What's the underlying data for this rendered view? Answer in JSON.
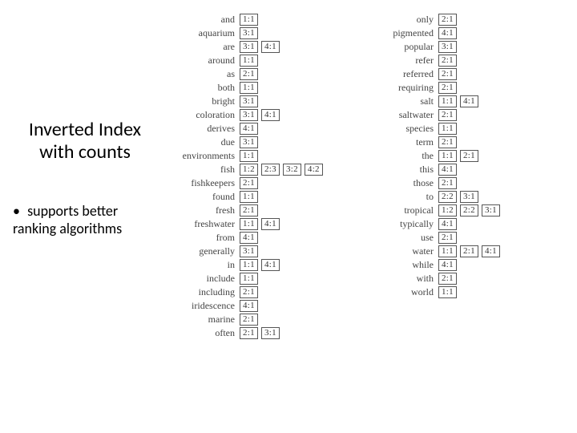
{
  "title_line1": "Inverted Index",
  "title_line2": "with counts",
  "bullet_dot": "•",
  "bullet_line1": "supports better",
  "bullet_line2": "ranking algorithms",
  "col1": [
    {
      "term": "and",
      "postings": [
        "1:1"
      ]
    },
    {
      "term": "aquarium",
      "postings": [
        "3:1"
      ]
    },
    {
      "term": "are",
      "postings": [
        "3:1",
        "4:1"
      ]
    },
    {
      "term": "around",
      "postings": [
        "1:1"
      ]
    },
    {
      "term": "as",
      "postings": [
        "2:1"
      ]
    },
    {
      "term": "both",
      "postings": [
        "1:1"
      ]
    },
    {
      "term": "bright",
      "postings": [
        "3:1"
      ]
    },
    {
      "term": "coloration",
      "postings": [
        "3:1",
        "4:1"
      ]
    },
    {
      "term": "derives",
      "postings": [
        "4:1"
      ]
    },
    {
      "term": "due",
      "postings": [
        "3:1"
      ]
    },
    {
      "term": "environments",
      "postings": [
        "1:1"
      ]
    },
    {
      "term": "fish",
      "postings": [
        "1:2",
        "2:3",
        "3:2",
        "4:2"
      ]
    },
    {
      "term": "fishkeepers",
      "postings": [
        "2:1"
      ]
    },
    {
      "term": "found",
      "postings": [
        "1:1"
      ]
    },
    {
      "term": "fresh",
      "postings": [
        "2:1"
      ]
    },
    {
      "term": "freshwater",
      "postings": [
        "1:1",
        "4:1"
      ]
    },
    {
      "term": "from",
      "postings": [
        "4:1"
      ]
    },
    {
      "term": "generally",
      "postings": [
        "3:1"
      ]
    },
    {
      "term": "in",
      "postings": [
        "1:1",
        "4:1"
      ]
    },
    {
      "term": "include",
      "postings": [
        "1:1"
      ]
    },
    {
      "term": "including",
      "postings": [
        "2:1"
      ]
    },
    {
      "term": "iridescence",
      "postings": [
        "4:1"
      ]
    },
    {
      "term": "marine",
      "postings": [
        "2:1"
      ]
    },
    {
      "term": "often",
      "postings": [
        "2:1",
        "3:1"
      ]
    }
  ],
  "col2": [
    {
      "term": "only",
      "postings": [
        "2:1"
      ]
    },
    {
      "term": "pigmented",
      "postings": [
        "4:1"
      ]
    },
    {
      "term": "popular",
      "postings": [
        "3:1"
      ]
    },
    {
      "term": "refer",
      "postings": [
        "2:1"
      ]
    },
    {
      "term": "referred",
      "postings": [
        "2:1"
      ]
    },
    {
      "term": "requiring",
      "postings": [
        "2:1"
      ]
    },
    {
      "term": "salt",
      "postings": [
        "1:1",
        "4:1"
      ]
    },
    {
      "term": "saltwater",
      "postings": [
        "2:1"
      ]
    },
    {
      "term": "species",
      "postings": [
        "1:1"
      ]
    },
    {
      "term": "term",
      "postings": [
        "2:1"
      ]
    },
    {
      "term": "the",
      "postings": [
        "1:1",
        "2:1"
      ]
    },
    {
      "term": "this",
      "postings": [
        "4:1"
      ]
    },
    {
      "term": "those",
      "postings": [
        "2:1"
      ]
    },
    {
      "term": "to",
      "postings": [
        "2:2",
        "3:1"
      ]
    },
    {
      "term": "tropical",
      "postings": [
        "1:2",
        "2:2",
        "3:1"
      ]
    },
    {
      "term": "typically",
      "postings": [
        "4:1"
      ]
    },
    {
      "term": "use",
      "postings": [
        "2:1"
      ]
    },
    {
      "term": "water",
      "postings": [
        "1:1",
        "2:1",
        "4:1"
      ]
    },
    {
      "term": "while",
      "postings": [
        "4:1"
      ]
    },
    {
      "term": "with",
      "postings": [
        "2:1"
      ]
    },
    {
      "term": "world",
      "postings": [
        "1:1"
      ]
    }
  ]
}
